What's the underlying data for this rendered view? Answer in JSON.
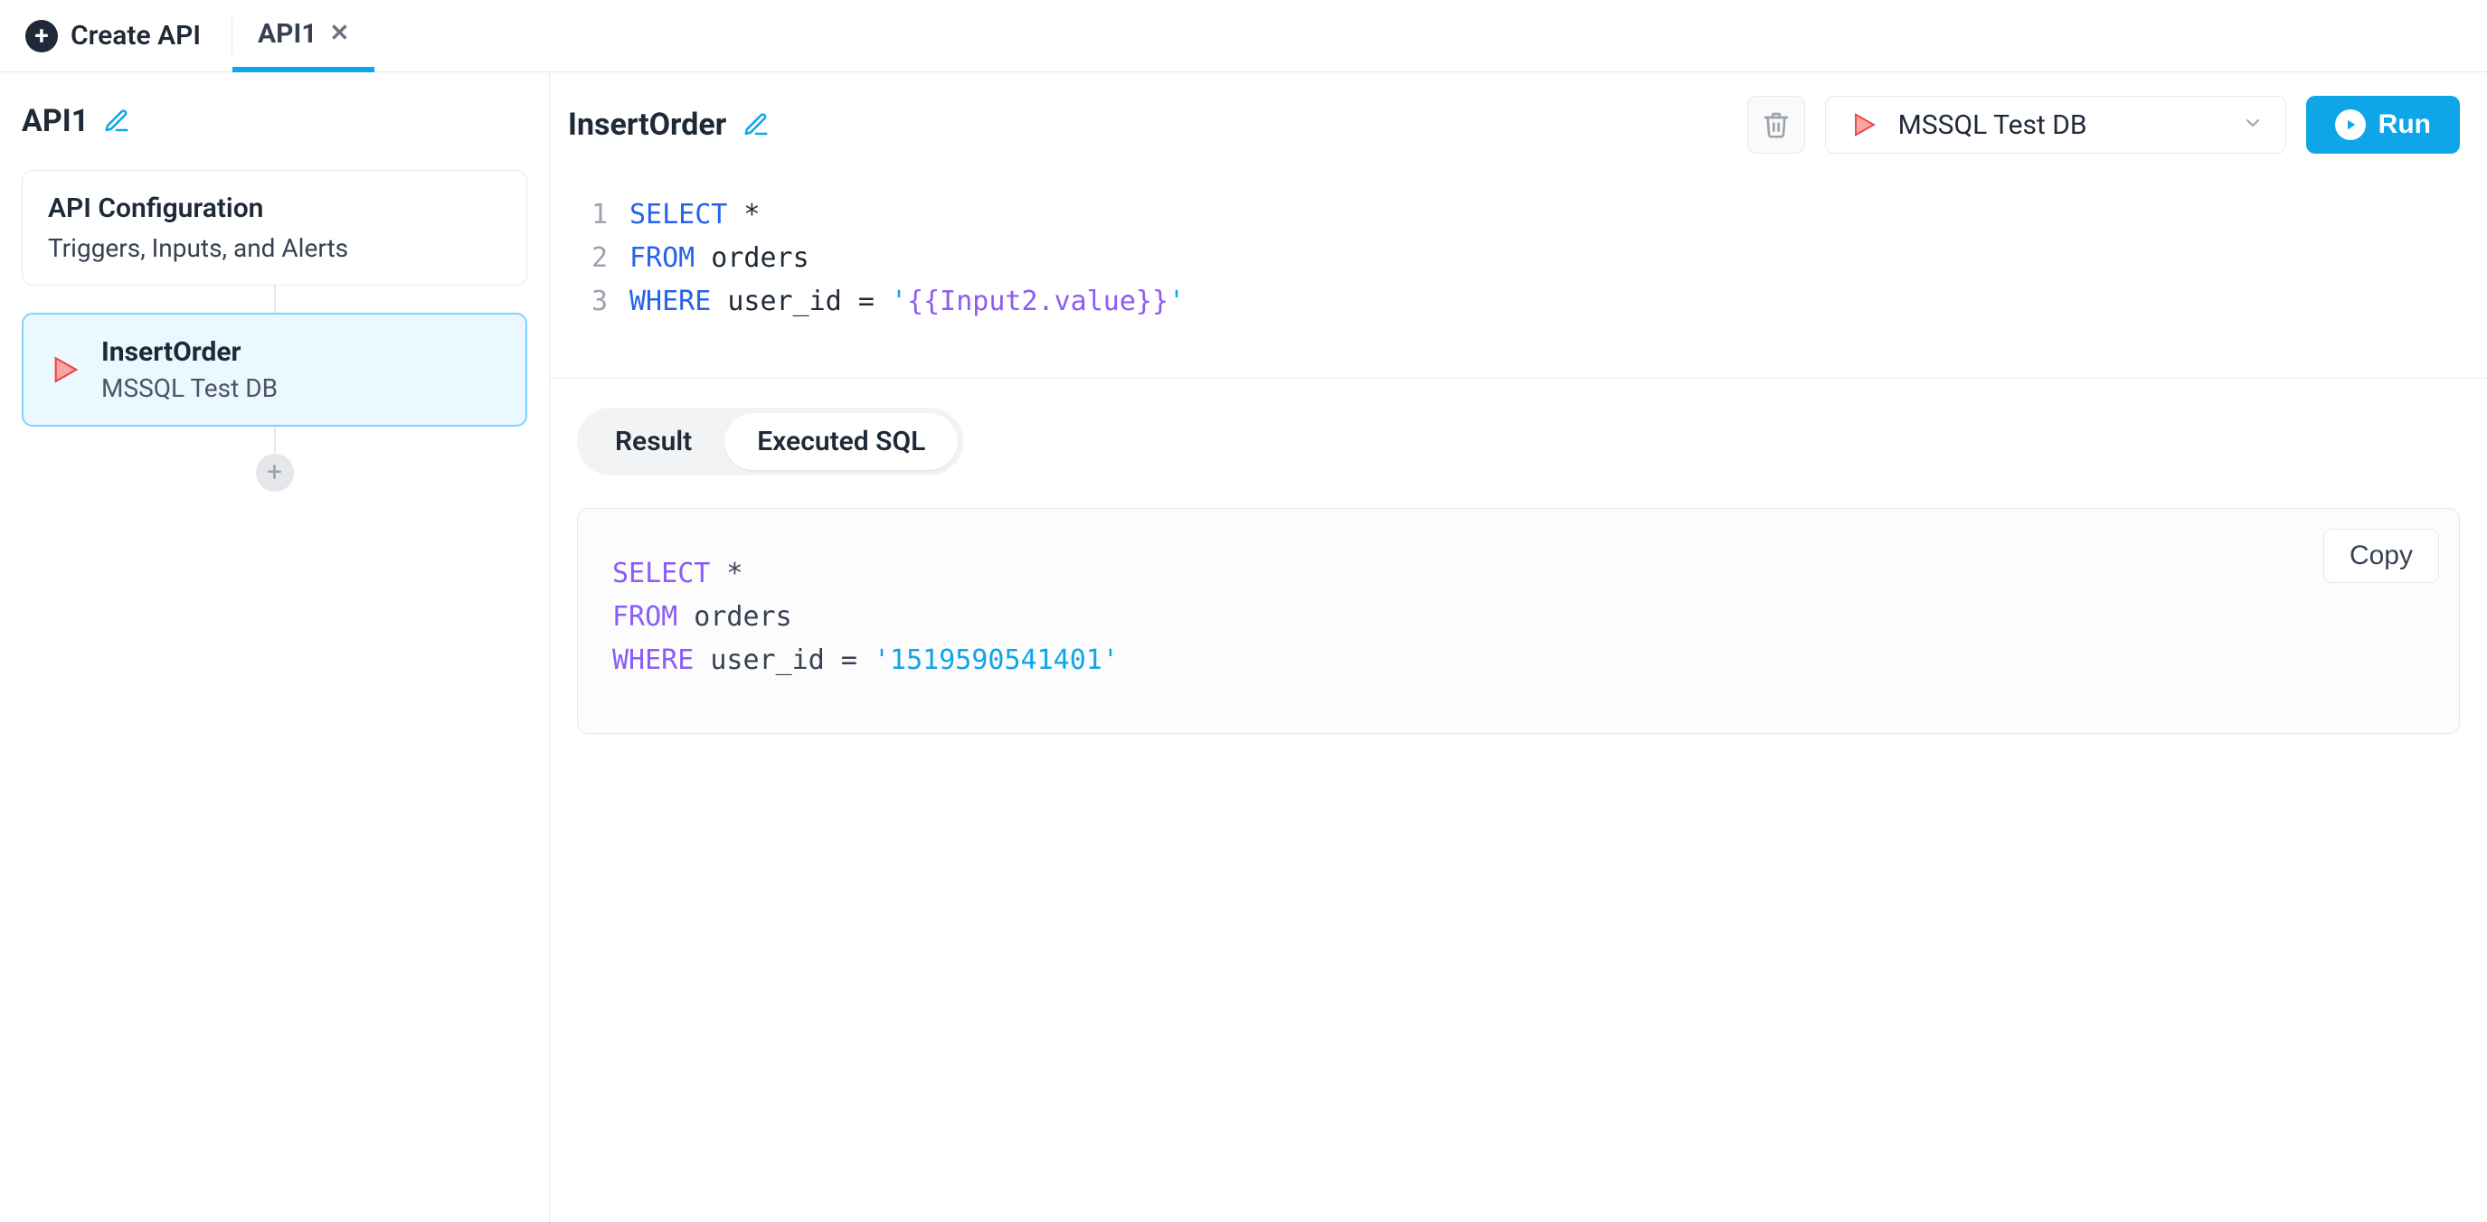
{
  "tab_bar": {
    "create_api_label": "Create API",
    "tab_label": "API1"
  },
  "sidebar": {
    "api_title": "API1",
    "config": {
      "title": "API Configuration",
      "subtitle": "Triggers, Inputs, and Alerts"
    },
    "step": {
      "name": "InsertOrder",
      "datasource": "MSSQL Test DB"
    }
  },
  "header": {
    "step_name": "InsertOrder",
    "datasource": "MSSQL Test DB",
    "run_label": "Run"
  },
  "editor": {
    "lines": [
      {
        "n": "1",
        "tokens": [
          {
            "t": "kw",
            "v": "SELECT"
          },
          {
            "t": "punct",
            "v": " *"
          }
        ]
      },
      {
        "n": "2",
        "tokens": [
          {
            "t": "kw",
            "v": "FROM"
          },
          {
            "t": "ident",
            "v": " orders"
          }
        ]
      },
      {
        "n": "3",
        "tokens": [
          {
            "t": "kw",
            "v": "WHERE"
          },
          {
            "t": "ident",
            "v": " user_id "
          },
          {
            "t": "punct",
            "v": "= "
          },
          {
            "t": "str",
            "v": "'"
          },
          {
            "t": "tmpl",
            "v": "{{Input2.value}}"
          },
          {
            "t": "str",
            "v": "'"
          }
        ]
      }
    ]
  },
  "result_tabs": {
    "result_label": "Result",
    "executed_label": "Executed SQL"
  },
  "executed": {
    "copy_label": "Copy",
    "lines": [
      [
        {
          "t": "exec-kw",
          "v": "SELECT"
        },
        {
          "t": "exec-ident",
          "v": " *"
        }
      ],
      [
        {
          "t": "exec-kw",
          "v": "FROM"
        },
        {
          "t": "exec-ident",
          "v": " orders"
        }
      ],
      [
        {
          "t": "exec-kw",
          "v": "WHERE"
        },
        {
          "t": "exec-ident",
          "v": " user_id = "
        },
        {
          "t": "exec-str",
          "v": "'1519590541401'"
        }
      ]
    ]
  }
}
